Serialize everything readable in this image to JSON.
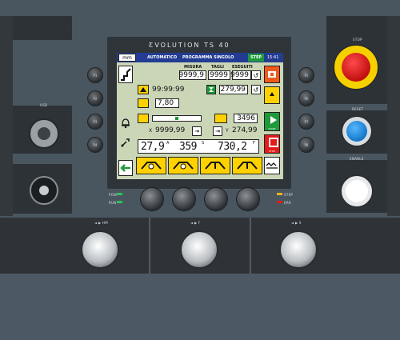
{
  "brand": {
    "title": "ƸVOLUTION TS 40"
  },
  "left_labels": [
    "P1",
    "P2",
    "P3",
    "P4"
  ],
  "right_labels": [
    "P5",
    "P6",
    "P7",
    "P8"
  ],
  "side_labels": {
    "usb": "USB",
    "stop": "STOP",
    "reset": "RESET",
    "enable": "ENABLE"
  },
  "indicators": {
    "pow": "POW",
    "run": "RUN",
    "step": "STEP",
    "err": "ERR"
  },
  "feet": {
    "left": "◄ ▶ HM",
    "mid": "◄ ▶ F",
    "right": "◄ ▶ S"
  },
  "screen": {
    "unit": "mm",
    "mode": "AUTOMATICO",
    "program": "PROGRAMMA SINGOLO",
    "step": "STEP",
    "time": "15:41",
    "headers": [
      "MISURA",
      "TAGLI",
      "ESEGUITI"
    ],
    "misura": "9999,9",
    "tagli": "9999",
    "eseguiti": "9999",
    "timer": "99:99:99",
    "speed_a": "279,99",
    "param": "7,80",
    "counter": "3496",
    "x_label": "X",
    "x_value": "9999,99",
    "y_label": "Y",
    "y_value": "274,99",
    "v1": "27,9",
    "v1_unit": "A",
    "v2": "359",
    "v2_unit": "S",
    "v3": "730,2",
    "v3_unit": "F",
    "start_label": "START",
    "stop_label": "STOP"
  },
  "colors": {
    "green": "#1e9a3a",
    "yellow": "#ffd100",
    "red": "#e31b1b",
    "blue": "#1f8fd6"
  }
}
